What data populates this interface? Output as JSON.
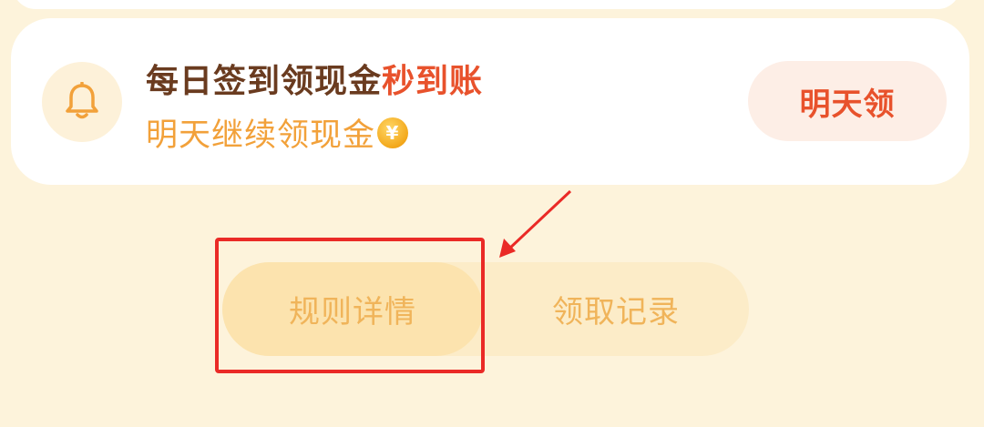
{
  "checkin_card": {
    "title_main": "每日签到领现金",
    "title_highlight": "秒到账",
    "subtitle": "明天继续领现金",
    "coin_symbol": "¥",
    "action_button": "明天领"
  },
  "tabs": [
    {
      "label": "规则详情"
    },
    {
      "label": "领取记录"
    }
  ],
  "colors": {
    "page_bg": "#fdf3db",
    "title": "#6a3b1f",
    "highlight": "#e8522c",
    "subtitle": "#f2a13a",
    "tab_text": "#f0b45a",
    "annotation": "#ea2a26"
  },
  "icons": {
    "bell": "bell-icon",
    "coin": "coin-icon"
  }
}
